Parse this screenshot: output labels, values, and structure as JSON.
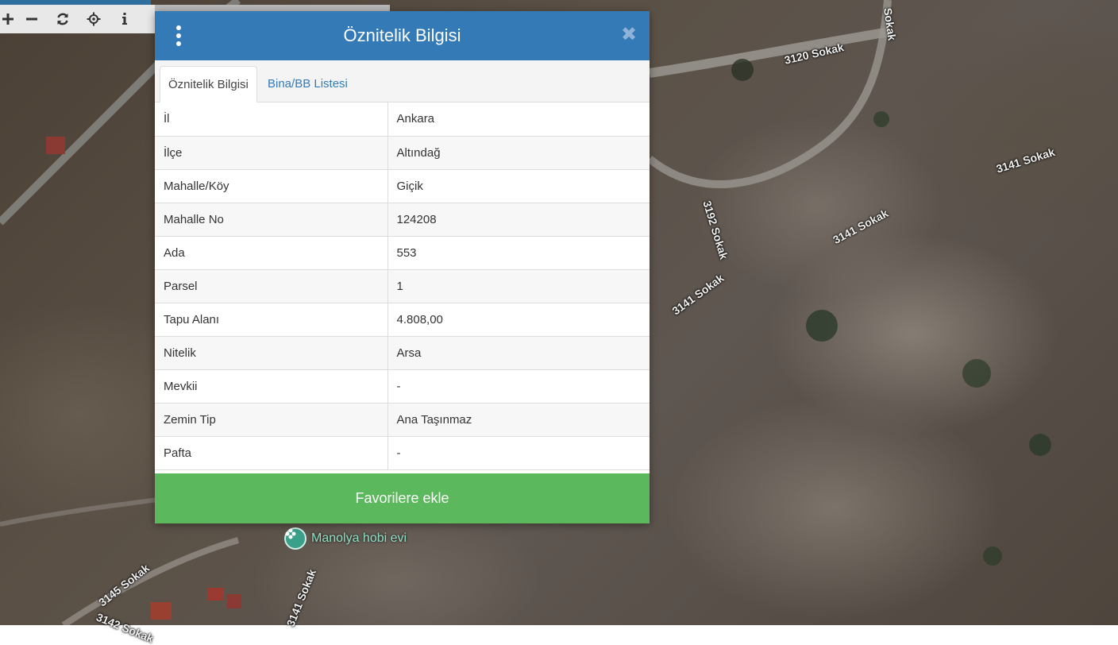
{
  "toolbar": {
    "buttons": [
      {
        "icon": "plus-icon"
      },
      {
        "icon": "minus-icon"
      },
      {
        "icon": "refresh-icon"
      },
      {
        "icon": "locate-icon"
      },
      {
        "icon": "info-icon"
      }
    ]
  },
  "map": {
    "road_labels": [
      "3120 Sokak",
      "3141 Sokak",
      "3141 Sokak",
      "3192 Sokak",
      "3141 Sokak",
      "3145 Sokak",
      "3142 Sokak",
      "3141 Sokak",
      "Sokak"
    ],
    "poi_label": "Manolya hobi evi"
  },
  "dialog": {
    "title": "Öznitelik Bilgisi",
    "tabs": [
      {
        "label": "Öznitelik Bilgisi",
        "active": true
      },
      {
        "label": "Bina/BB Listesi",
        "active": false
      }
    ],
    "rows": [
      {
        "label": "İl",
        "value": "Ankara"
      },
      {
        "label": "İlçe",
        "value": "Altındağ"
      },
      {
        "label": "Mahalle/Köy",
        "value": "Giçik"
      },
      {
        "label": "Mahalle No",
        "value": "124208"
      },
      {
        "label": "Ada",
        "value": "553"
      },
      {
        "label": "Parsel",
        "value": "1"
      },
      {
        "label": "Tapu Alanı",
        "value": "4.808,00"
      },
      {
        "label": "Nitelik",
        "value": "Arsa"
      },
      {
        "label": "Mevkii",
        "value": "-"
      },
      {
        "label": "Zemin Tip",
        "value": "Ana Taşınmaz"
      },
      {
        "label": "Pafta",
        "value": "-"
      }
    ],
    "favorite_button": "Favorilere ekle",
    "close_symbol": "✖"
  },
  "colors": {
    "header": "#337ab7",
    "favorite": "#5cb85c",
    "tab_link": "#337ab7"
  }
}
